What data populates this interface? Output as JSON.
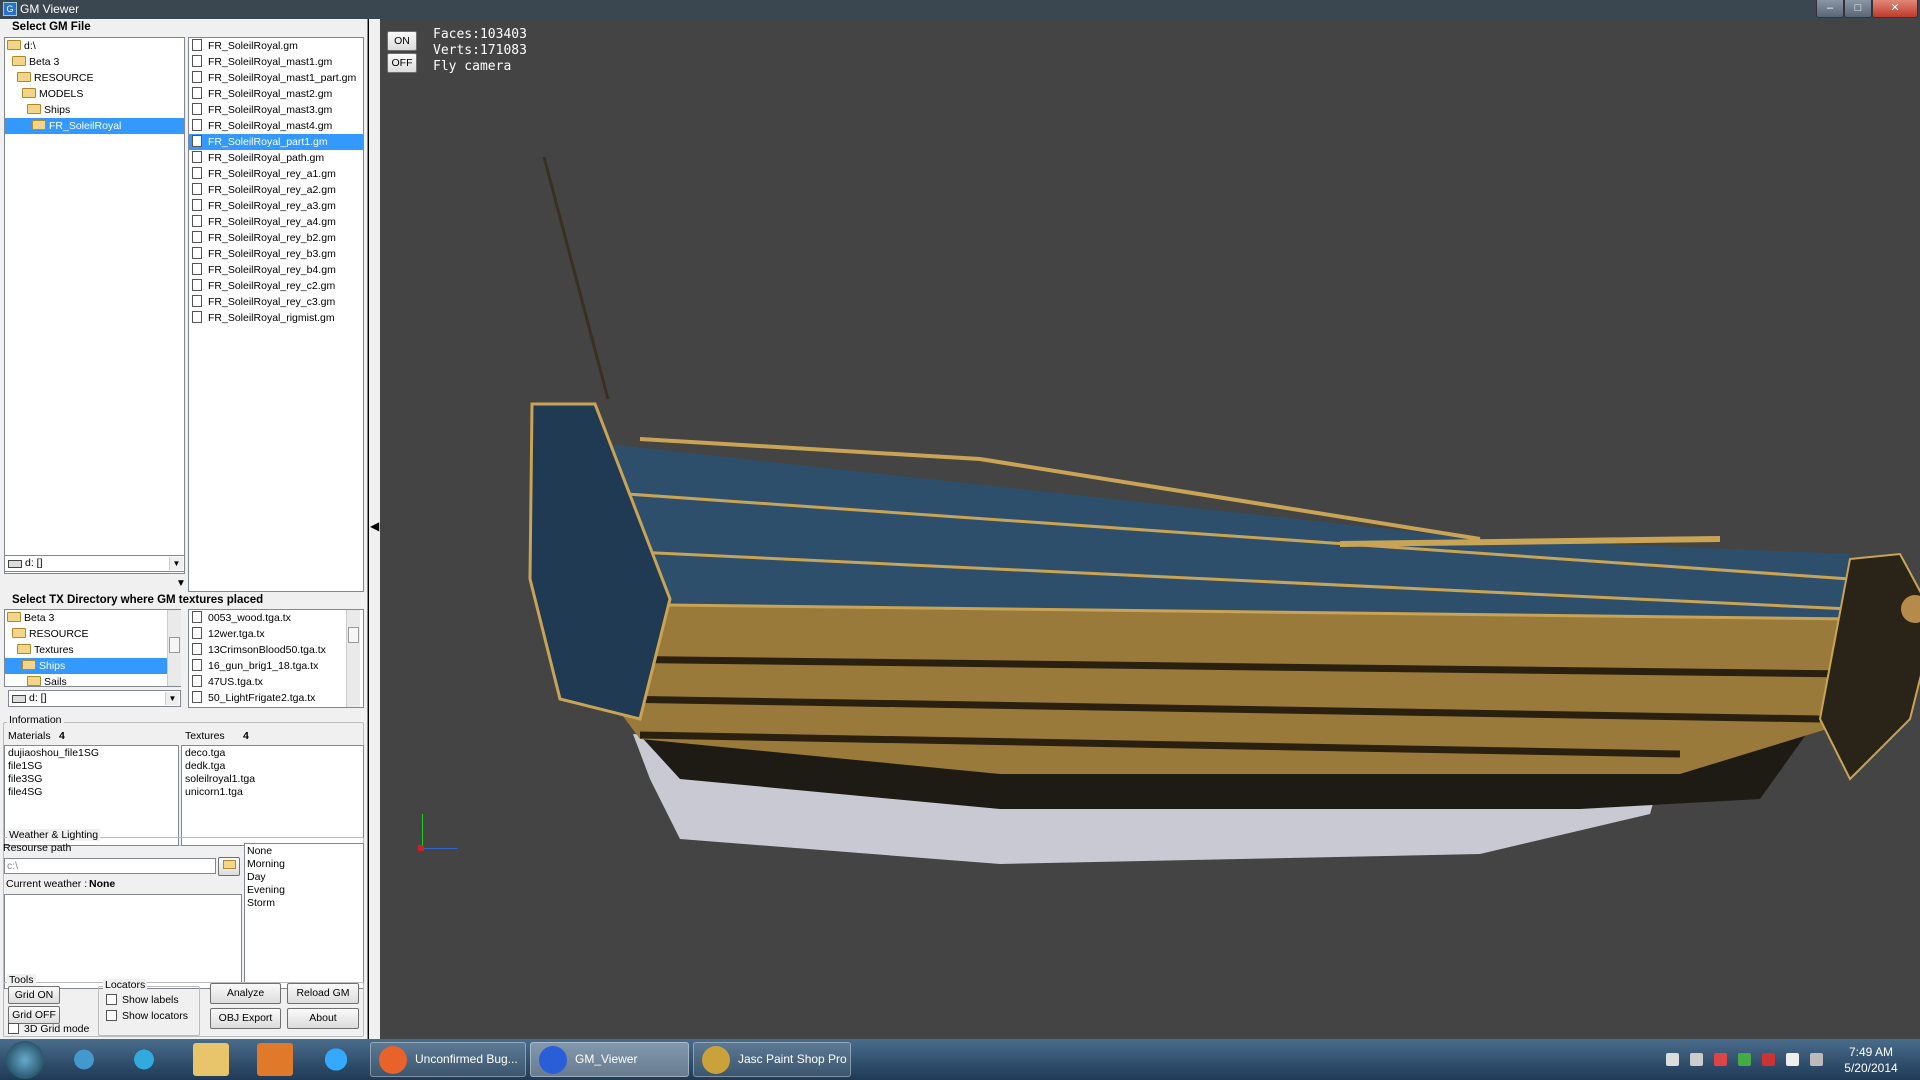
{
  "window": {
    "title": "GM Viewer"
  },
  "gm_section": {
    "heading": "Select GM File"
  },
  "gm_tree": [
    {
      "label": "d:\\",
      "indent": 0,
      "selected": false
    },
    {
      "label": "Beta 3",
      "indent": 1,
      "selected": false
    },
    {
      "label": "RESOURCE",
      "indent": 2,
      "selected": false
    },
    {
      "label": "MODELS",
      "indent": 3,
      "selected": false
    },
    {
      "label": "Ships",
      "indent": 4,
      "selected": false
    },
    {
      "label": "FR_SoleilRoyal",
      "indent": 5,
      "selected": true
    }
  ],
  "gm_drive": "d: []",
  "gm_files": [
    {
      "name": "FR_SoleilRoyal.gm",
      "selected": false
    },
    {
      "name": "FR_SoleilRoyal_mast1.gm",
      "selected": false
    },
    {
      "name": "FR_SoleilRoyal_mast1_part.gm",
      "selected": false
    },
    {
      "name": "FR_SoleilRoyal_mast2.gm",
      "selected": false
    },
    {
      "name": "FR_SoleilRoyal_mast3.gm",
      "selected": false
    },
    {
      "name": "FR_SoleilRoyal_mast4.gm",
      "selected": false
    },
    {
      "name": "FR_SoleilRoyal_part1.gm",
      "selected": true
    },
    {
      "name": "FR_SoleilRoyal_path.gm",
      "selected": false
    },
    {
      "name": "FR_SoleilRoyal_rey_a1.gm",
      "selected": false
    },
    {
      "name": "FR_SoleilRoyal_rey_a2.gm",
      "selected": false
    },
    {
      "name": "FR_SoleilRoyal_rey_a3.gm",
      "selected": false
    },
    {
      "name": "FR_SoleilRoyal_rey_a4.gm",
      "selected": false
    },
    {
      "name": "FR_SoleilRoyal_rey_b2.gm",
      "selected": false
    },
    {
      "name": "FR_SoleilRoyal_rey_b3.gm",
      "selected": false
    },
    {
      "name": "FR_SoleilRoyal_rey_b4.gm",
      "selected": false
    },
    {
      "name": "FR_SoleilRoyal_rey_c2.gm",
      "selected": false
    },
    {
      "name": "FR_SoleilRoyal_rey_c3.gm",
      "selected": false
    },
    {
      "name": "FR_SoleilRoyal_rigmist.gm",
      "selected": false
    }
  ],
  "tx_section": {
    "heading": "Select TX Directory where GM textures placed"
  },
  "tx_tree": [
    {
      "label": "Beta 3",
      "indent": 0,
      "selected": false
    },
    {
      "label": "RESOURCE",
      "indent": 1,
      "selected": false
    },
    {
      "label": "Textures",
      "indent": 2,
      "selected": false
    },
    {
      "label": "Ships",
      "indent": 3,
      "selected": true
    },
    {
      "label": "Sails",
      "indent": 4,
      "selected": false
    }
  ],
  "tx_drive": "d: []",
  "tx_files": [
    "0053_wood.tga.tx",
    "12wer.tga.tx",
    "13CrimsonBlood50.tga.tx",
    "16_gun_brig1_18.tga.tx",
    "47US.tga.tx",
    "50_LightFrigate2.tga.tx"
  ],
  "info": {
    "group_label": "Information",
    "materials_label": "Materials",
    "materials_count": "4",
    "textures_label": "Textures",
    "textures_count": "4",
    "materials": [
      "dujiaoshou_file1SG",
      "file1SG",
      "file3SG",
      "file4SG"
    ],
    "textures": [
      "deco.tga",
      "dedk.tga",
      "soleilroyal1.tga",
      "unicorn1.tga"
    ]
  },
  "weather": {
    "group_label": "Weather & Lighting",
    "resource_path_label": "Resourse path",
    "resource_path_value": "c:\\",
    "current_label": "Current weather :",
    "current_value": "None",
    "options": [
      "None",
      "Morning",
      "Day",
      "Evening",
      "Storm"
    ]
  },
  "tools": {
    "group_label": "Tools",
    "grid_on": "Grid ON",
    "grid_off": "Grid OFF",
    "grid_3d": "3D Grid mode",
    "locators_label": "Locators",
    "show_labels": "Show labels",
    "show_locators": "Show locators",
    "analyze": "Analyze",
    "reload_gm": "Reload GM",
    "obj_export": "OBJ Export",
    "about": "About"
  },
  "viewport": {
    "on_label": "ON",
    "off_label": "OFF",
    "faces": "Faces:103403",
    "verts": "Verts:171083",
    "camera": "Fly camera",
    "background": "#444444"
  },
  "taskbar": {
    "items": [
      {
        "label": "Unconfirmed Bug...",
        "icon": "firefox-icon",
        "active": false
      },
      {
        "label": "GM_Viewer",
        "icon": "gm-viewer-icon",
        "active": true
      },
      {
        "label": "Jasc Paint Shop Pro",
        "icon": "paint-shop-icon",
        "active": false
      }
    ],
    "time": "7:49 AM",
    "date": "5/20/2014"
  }
}
